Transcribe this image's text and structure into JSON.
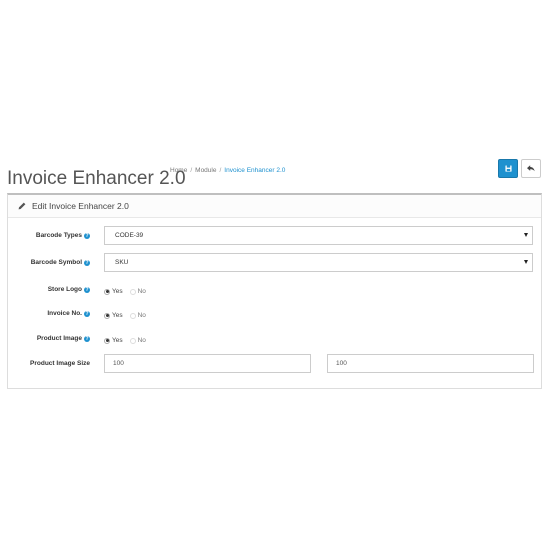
{
  "header": {
    "title": "Invoice Enhancer 2.0",
    "breadcrumb": [
      "Home",
      "Module",
      "Invoice Enhancer 2.0"
    ],
    "breadcrumb_sep": "/"
  },
  "toolbar": {
    "save_icon": "save-icon",
    "back_icon": "reply-icon"
  },
  "panel": {
    "heading": "Edit Invoice Enhancer 2.0",
    "heading_icon": "pencil-icon"
  },
  "form": {
    "help_glyph": "?",
    "barcode_types": {
      "label": "Barcode Types",
      "value": "CODE-39"
    },
    "barcode_symbol": {
      "label": "Barcode Symbol",
      "value": "SKU"
    },
    "store_logo": {
      "label": "Store Logo",
      "yes": "Yes",
      "no": "No",
      "selected": "Yes"
    },
    "invoice_no": {
      "label": "Invoice No.",
      "yes": "Yes",
      "no": "No",
      "selected": "Yes"
    },
    "product_image": {
      "label": "Product Image",
      "yes": "Yes",
      "no": "No",
      "selected": "Yes"
    },
    "product_image_size": {
      "label": "Product Image Size",
      "width": "100",
      "height": "100"
    }
  },
  "colors": {
    "accent": "#1e91cf",
    "border": "#cccccc"
  }
}
